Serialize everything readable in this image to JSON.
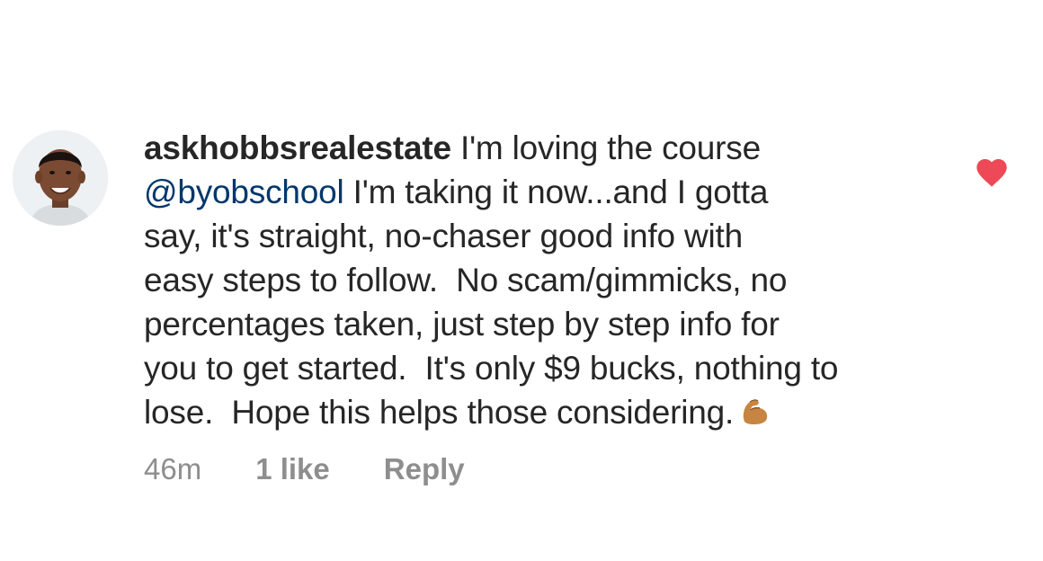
{
  "comment": {
    "username": "askhobbsrealestate",
    "line1_text": " I'm loving the course",
    "mention": "@byobschool",
    "line2_text": " I'm taking it now...and I gotta",
    "lines": [
      "say, it's straight, no-chaser good info with",
      "easy steps to follow.  No scam/gimmicks, no",
      "percentages taken, just step by step info for",
      "you to get started.  It's only $9 bucks, nothing to",
      "lose.  Hope this helps those considering."
    ],
    "emoji_icon": "flexed-biceps-icon",
    "time": "46m",
    "likes": "1 like",
    "reply_label": "Reply",
    "liked": true,
    "like_icon": "heart-icon",
    "heart_color": "#ed4956",
    "mention_color": "#00376b"
  }
}
